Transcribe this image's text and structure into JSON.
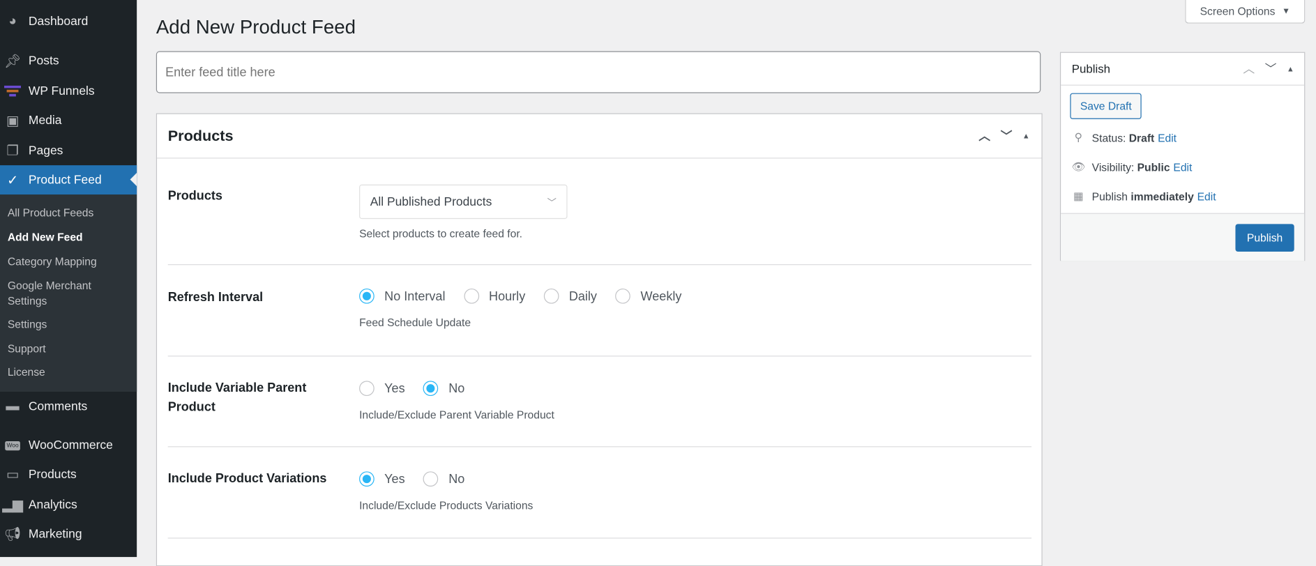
{
  "sidebar": {
    "items": [
      {
        "label": "Dashboard",
        "icon": "dashboard-icon"
      },
      {
        "label": "Posts",
        "icon": "pin-icon"
      },
      {
        "label": "WP Funnels",
        "icon": "funnel-icon"
      },
      {
        "label": "Media",
        "icon": "media-icon"
      },
      {
        "label": "Pages",
        "icon": "pages-icon"
      },
      {
        "label": "Product Feed",
        "icon": "product-feed-icon"
      },
      {
        "label": "Comments",
        "icon": "comment-icon"
      },
      {
        "label": "WooCommerce",
        "icon": "woo-icon"
      },
      {
        "label": "Products",
        "icon": "archive-icon"
      },
      {
        "label": "Analytics",
        "icon": "bar-chart-icon"
      },
      {
        "label": "Marketing",
        "icon": "megaphone-icon"
      }
    ],
    "woo_badge": "Woo",
    "submenu": [
      "All Product Feeds",
      "Add New Feed",
      "Category Mapping",
      "Google Merchant Settings",
      "Settings",
      "Support",
      "License"
    ]
  },
  "header": {
    "title": "Add New Product Feed",
    "screen_options": "Screen Options"
  },
  "feed_title": {
    "placeholder": "Enter feed title here",
    "value": ""
  },
  "products_box": {
    "title": "Products",
    "products": {
      "label": "Products",
      "selected": "All Published Products",
      "desc": "Select products to create feed for."
    },
    "refresh": {
      "label": "Refresh Interval",
      "options": [
        "No Interval",
        "Hourly",
        "Daily",
        "Weekly"
      ],
      "selected": "No Interval",
      "desc": "Feed Schedule Update"
    },
    "variable_parent": {
      "label": "Include Variable Parent Product",
      "options": [
        "Yes",
        "No"
      ],
      "selected": "No",
      "desc": "Include/Exclude Parent Variable Product"
    },
    "variations": {
      "label": "Include Product Variations",
      "options": [
        "Yes",
        "No"
      ],
      "selected": "Yes",
      "desc": "Include/Exclude Products Variations"
    }
  },
  "publish": {
    "title": "Publish",
    "save_draft": "Save Draft",
    "status_label": "Status:",
    "status": "Draft",
    "visibility_label": "Visibility:",
    "visibility": "Public",
    "publish_label": "Publish",
    "publish_when": "immediately",
    "edit": "Edit",
    "publish_button": "Publish"
  },
  "colors": {
    "accent": "#2271b1",
    "radio": "#29b6f6",
    "sidebar": "#1d2327"
  }
}
